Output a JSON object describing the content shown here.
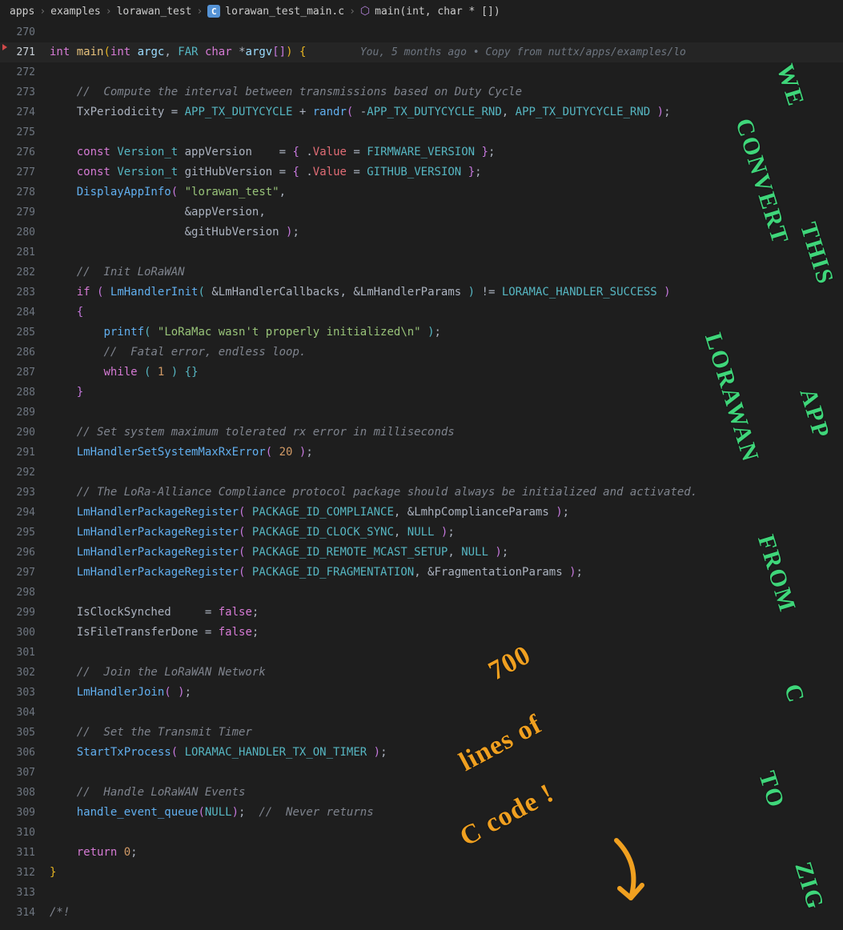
{
  "breadcrumbs": {
    "seg0": "apps",
    "seg1": "examples",
    "seg2": "lorawan_test",
    "seg3": "lorawan_test_main.c",
    "seg4": "main(int, char * [])",
    "c_icon": "C"
  },
  "codelens": "You, 5 months ago • Copy from nuttx/apps/examples/lo",
  "annot": {
    "g1": "We",
    "g2": "convert",
    "g3": "this",
    "g4": "LoRaWAN",
    "g5": "App",
    "g6": "from",
    "g7": "C",
    "g8": "to",
    "g9": "Zig",
    "o1": "700",
    "o2": "lines of",
    "o3": "C code !"
  },
  "lines": [
    {
      "n": "270",
      "t": []
    },
    {
      "n": "271",
      "hl": true,
      "t": [
        {
          "c": "kw",
          "v": "int"
        },
        {
          "c": "op",
          "v": " "
        },
        {
          "c": "fn",
          "v": "main"
        },
        {
          "c": "brace",
          "v": "("
        },
        {
          "c": "kw",
          "v": "int"
        },
        {
          "c": "op",
          "v": " "
        },
        {
          "c": "param",
          "v": "argc"
        },
        {
          "c": "op",
          "v": ", "
        },
        {
          "c": "type",
          "v": "FAR"
        },
        {
          "c": "op",
          "v": " "
        },
        {
          "c": "kw",
          "v": "char"
        },
        {
          "c": "op",
          "v": " *"
        },
        {
          "c": "param",
          "v": "argv"
        },
        {
          "c": "brace2",
          "v": "["
        },
        {
          "c": "brace2",
          "v": "]"
        },
        {
          "c": "brace",
          "v": ")"
        },
        {
          "c": "op",
          "v": " "
        },
        {
          "c": "brace",
          "v": "{"
        }
      ],
      "lens": true
    },
    {
      "n": "272",
      "t": []
    },
    {
      "n": "273",
      "t": [
        {
          "c": "op",
          "v": "    "
        },
        {
          "c": "cmt",
          "v": "//  Compute the interval between transmissions based on Duty Cycle"
        }
      ]
    },
    {
      "n": "274",
      "t": [
        {
          "c": "op",
          "v": "    "
        },
        {
          "c": "var",
          "v": "TxPeriodicity"
        },
        {
          "c": "op",
          "v": " = "
        },
        {
          "c": "const",
          "v": "APP_TX_DUTYCYCLE"
        },
        {
          "c": "op",
          "v": " + "
        },
        {
          "c": "call",
          "v": "randr"
        },
        {
          "c": "brace2",
          "v": "("
        },
        {
          "c": "op",
          "v": " -"
        },
        {
          "c": "const",
          "v": "APP_TX_DUTYCYCLE_RND"
        },
        {
          "c": "op",
          "v": ", "
        },
        {
          "c": "const",
          "v": "APP_TX_DUTYCYCLE_RND"
        },
        {
          "c": "op",
          "v": " "
        },
        {
          "c": "brace2",
          "v": ")"
        },
        {
          "c": "op",
          "v": ";"
        }
      ]
    },
    {
      "n": "275",
      "t": []
    },
    {
      "n": "276",
      "t": [
        {
          "c": "op",
          "v": "    "
        },
        {
          "c": "kw",
          "v": "const"
        },
        {
          "c": "op",
          "v": " "
        },
        {
          "c": "type",
          "v": "Version_t"
        },
        {
          "c": "op",
          "v": " "
        },
        {
          "c": "var",
          "v": "appVersion"
        },
        {
          "c": "op",
          "v": "    = "
        },
        {
          "c": "brace2",
          "v": "{"
        },
        {
          "c": "op",
          "v": " ."
        },
        {
          "c": "prop",
          "v": "Value"
        },
        {
          "c": "op",
          "v": " = "
        },
        {
          "c": "const",
          "v": "FIRMWARE_VERSION"
        },
        {
          "c": "op",
          "v": " "
        },
        {
          "c": "brace2",
          "v": "}"
        },
        {
          "c": "op",
          "v": ";"
        }
      ]
    },
    {
      "n": "277",
      "t": [
        {
          "c": "op",
          "v": "    "
        },
        {
          "c": "kw",
          "v": "const"
        },
        {
          "c": "op",
          "v": " "
        },
        {
          "c": "type",
          "v": "Version_t"
        },
        {
          "c": "op",
          "v": " "
        },
        {
          "c": "var",
          "v": "gitHubVersion"
        },
        {
          "c": "op",
          "v": " = "
        },
        {
          "c": "brace2",
          "v": "{"
        },
        {
          "c": "op",
          "v": " ."
        },
        {
          "c": "prop",
          "v": "Value"
        },
        {
          "c": "op",
          "v": " = "
        },
        {
          "c": "const",
          "v": "GITHUB_VERSION"
        },
        {
          "c": "op",
          "v": " "
        },
        {
          "c": "brace2",
          "v": "}"
        },
        {
          "c": "op",
          "v": ";"
        }
      ]
    },
    {
      "n": "278",
      "t": [
        {
          "c": "op",
          "v": "    "
        },
        {
          "c": "call",
          "v": "DisplayAppInfo"
        },
        {
          "c": "brace2",
          "v": "("
        },
        {
          "c": "op",
          "v": " "
        },
        {
          "c": "str",
          "v": "\"lorawan_test\""
        },
        {
          "c": "op",
          "v": ","
        }
      ]
    },
    {
      "n": "279",
      "t": [
        {
          "c": "op",
          "v": "                    &"
        },
        {
          "c": "var",
          "v": "appVersion"
        },
        {
          "c": "op",
          "v": ","
        }
      ]
    },
    {
      "n": "280",
      "t": [
        {
          "c": "op",
          "v": "                    &"
        },
        {
          "c": "var",
          "v": "gitHubVersion"
        },
        {
          "c": "op",
          "v": " "
        },
        {
          "c": "brace2",
          "v": ")"
        },
        {
          "c": "op",
          "v": ";"
        }
      ]
    },
    {
      "n": "281",
      "t": []
    },
    {
      "n": "282",
      "t": [
        {
          "c": "op",
          "v": "    "
        },
        {
          "c": "cmt",
          "v": "//  Init LoRaWAN"
        }
      ]
    },
    {
      "n": "283",
      "t": [
        {
          "c": "op",
          "v": "    "
        },
        {
          "c": "kw",
          "v": "if"
        },
        {
          "c": "op",
          "v": " "
        },
        {
          "c": "brace2",
          "v": "("
        },
        {
          "c": "op",
          "v": " "
        },
        {
          "c": "call",
          "v": "LmHandlerInit"
        },
        {
          "c": "brace3",
          "v": "("
        },
        {
          "c": "op",
          "v": " &"
        },
        {
          "c": "var",
          "v": "LmHandlerCallbacks"
        },
        {
          "c": "op",
          "v": ", &"
        },
        {
          "c": "var",
          "v": "LmHandlerParams"
        },
        {
          "c": "op",
          "v": " "
        },
        {
          "c": "brace3",
          "v": ")"
        },
        {
          "c": "op",
          "v": " != "
        },
        {
          "c": "const",
          "v": "LORAMAC_HANDLER_SUCCESS"
        },
        {
          "c": "op",
          "v": " "
        },
        {
          "c": "brace2",
          "v": ")"
        }
      ]
    },
    {
      "n": "284",
      "t": [
        {
          "c": "op",
          "v": "    "
        },
        {
          "c": "brace2",
          "v": "{"
        }
      ]
    },
    {
      "n": "285",
      "t": [
        {
          "c": "op",
          "v": "        "
        },
        {
          "c": "call",
          "v": "printf"
        },
        {
          "c": "brace3",
          "v": "("
        },
        {
          "c": "op",
          "v": " "
        },
        {
          "c": "str",
          "v": "\"LoRaMac wasn't properly initialized\\n\""
        },
        {
          "c": "op",
          "v": " "
        },
        {
          "c": "brace3",
          "v": ")"
        },
        {
          "c": "op",
          "v": ";"
        }
      ]
    },
    {
      "n": "286",
      "t": [
        {
          "c": "op",
          "v": "        "
        },
        {
          "c": "cmt",
          "v": "//  Fatal error, endless loop."
        }
      ]
    },
    {
      "n": "287",
      "t": [
        {
          "c": "op",
          "v": "        "
        },
        {
          "c": "kw",
          "v": "while"
        },
        {
          "c": "op",
          "v": " "
        },
        {
          "c": "brace3",
          "v": "("
        },
        {
          "c": "op",
          "v": " "
        },
        {
          "c": "num",
          "v": "1"
        },
        {
          "c": "op",
          "v": " "
        },
        {
          "c": "brace3",
          "v": ")"
        },
        {
          "c": "op",
          "v": " "
        },
        {
          "c": "brace3",
          "v": "{"
        },
        {
          "c": "brace3",
          "v": "}"
        }
      ]
    },
    {
      "n": "288",
      "t": [
        {
          "c": "op",
          "v": "    "
        },
        {
          "c": "brace2",
          "v": "}"
        }
      ]
    },
    {
      "n": "289",
      "t": []
    },
    {
      "n": "290",
      "t": [
        {
          "c": "op",
          "v": "    "
        },
        {
          "c": "cmt",
          "v": "// Set system maximum tolerated rx error in milliseconds"
        }
      ]
    },
    {
      "n": "291",
      "t": [
        {
          "c": "op",
          "v": "    "
        },
        {
          "c": "call",
          "v": "LmHandlerSetSystemMaxRxError"
        },
        {
          "c": "brace2",
          "v": "("
        },
        {
          "c": "op",
          "v": " "
        },
        {
          "c": "num",
          "v": "20"
        },
        {
          "c": "op",
          "v": " "
        },
        {
          "c": "brace2",
          "v": ")"
        },
        {
          "c": "op",
          "v": ";"
        }
      ]
    },
    {
      "n": "292",
      "t": []
    },
    {
      "n": "293",
      "t": [
        {
          "c": "op",
          "v": "    "
        },
        {
          "c": "cmt",
          "v": "// The LoRa-Alliance Compliance protocol package should always be initialized and activated."
        }
      ]
    },
    {
      "n": "294",
      "t": [
        {
          "c": "op",
          "v": "    "
        },
        {
          "c": "call",
          "v": "LmHandlerPackageRegister"
        },
        {
          "c": "brace2",
          "v": "("
        },
        {
          "c": "op",
          "v": " "
        },
        {
          "c": "const",
          "v": "PACKAGE_ID_COMPLIANCE"
        },
        {
          "c": "op",
          "v": ", &"
        },
        {
          "c": "var",
          "v": "LmhpComplianceParams"
        },
        {
          "c": "op",
          "v": " "
        },
        {
          "c": "brace2",
          "v": ")"
        },
        {
          "c": "op",
          "v": ";"
        }
      ]
    },
    {
      "n": "295",
      "t": [
        {
          "c": "op",
          "v": "    "
        },
        {
          "c": "call",
          "v": "LmHandlerPackageRegister"
        },
        {
          "c": "brace2",
          "v": "("
        },
        {
          "c": "op",
          "v": " "
        },
        {
          "c": "const",
          "v": "PACKAGE_ID_CLOCK_SYNC"
        },
        {
          "c": "op",
          "v": ", "
        },
        {
          "c": "const",
          "v": "NULL"
        },
        {
          "c": "op",
          "v": " "
        },
        {
          "c": "brace2",
          "v": ")"
        },
        {
          "c": "op",
          "v": ";"
        }
      ]
    },
    {
      "n": "296",
      "t": [
        {
          "c": "op",
          "v": "    "
        },
        {
          "c": "call",
          "v": "LmHandlerPackageRegister"
        },
        {
          "c": "brace2",
          "v": "("
        },
        {
          "c": "op",
          "v": " "
        },
        {
          "c": "const",
          "v": "PACKAGE_ID_REMOTE_MCAST_SETUP"
        },
        {
          "c": "op",
          "v": ", "
        },
        {
          "c": "const",
          "v": "NULL"
        },
        {
          "c": "op",
          "v": " "
        },
        {
          "c": "brace2",
          "v": ")"
        },
        {
          "c": "op",
          "v": ";"
        }
      ]
    },
    {
      "n": "297",
      "t": [
        {
          "c": "op",
          "v": "    "
        },
        {
          "c": "call",
          "v": "LmHandlerPackageRegister"
        },
        {
          "c": "brace2",
          "v": "("
        },
        {
          "c": "op",
          "v": " "
        },
        {
          "c": "const",
          "v": "PACKAGE_ID_FRAGMENTATION"
        },
        {
          "c": "op",
          "v": ", &"
        },
        {
          "c": "var",
          "v": "FragmentationParams"
        },
        {
          "c": "op",
          "v": " "
        },
        {
          "c": "brace2",
          "v": ")"
        },
        {
          "c": "op",
          "v": ";"
        }
      ]
    },
    {
      "n": "298",
      "t": []
    },
    {
      "n": "299",
      "t": [
        {
          "c": "op",
          "v": "    "
        },
        {
          "c": "var",
          "v": "IsClockSynched"
        },
        {
          "c": "op",
          "v": "     = "
        },
        {
          "c": "kw",
          "v": "false"
        },
        {
          "c": "op",
          "v": ";"
        }
      ]
    },
    {
      "n": "300",
      "t": [
        {
          "c": "op",
          "v": "    "
        },
        {
          "c": "var",
          "v": "IsFileTransferDone"
        },
        {
          "c": "op",
          "v": " = "
        },
        {
          "c": "kw",
          "v": "false"
        },
        {
          "c": "op",
          "v": ";"
        }
      ]
    },
    {
      "n": "301",
      "t": []
    },
    {
      "n": "302",
      "t": [
        {
          "c": "op",
          "v": "    "
        },
        {
          "c": "cmt",
          "v": "//  Join the LoRaWAN Network"
        }
      ]
    },
    {
      "n": "303",
      "t": [
        {
          "c": "op",
          "v": "    "
        },
        {
          "c": "call",
          "v": "LmHandlerJoin"
        },
        {
          "c": "brace2",
          "v": "("
        },
        {
          "c": "op",
          "v": " "
        },
        {
          "c": "brace2",
          "v": ")"
        },
        {
          "c": "op",
          "v": ";"
        }
      ]
    },
    {
      "n": "304",
      "t": []
    },
    {
      "n": "305",
      "t": [
        {
          "c": "op",
          "v": "    "
        },
        {
          "c": "cmt",
          "v": "//  Set the Transmit Timer"
        }
      ]
    },
    {
      "n": "306",
      "t": [
        {
          "c": "op",
          "v": "    "
        },
        {
          "c": "call",
          "v": "StartTxProcess"
        },
        {
          "c": "brace2",
          "v": "("
        },
        {
          "c": "op",
          "v": " "
        },
        {
          "c": "const",
          "v": "LORAMAC_HANDLER_TX_ON_TIMER"
        },
        {
          "c": "op",
          "v": " "
        },
        {
          "c": "brace2",
          "v": ")"
        },
        {
          "c": "op",
          "v": ";"
        }
      ]
    },
    {
      "n": "307",
      "t": []
    },
    {
      "n": "308",
      "t": [
        {
          "c": "op",
          "v": "    "
        },
        {
          "c": "cmt",
          "v": "//  Handle LoRaWAN Events"
        }
      ]
    },
    {
      "n": "309",
      "t": [
        {
          "c": "op",
          "v": "    "
        },
        {
          "c": "call",
          "v": "handle_event_queue"
        },
        {
          "c": "brace2",
          "v": "("
        },
        {
          "c": "const",
          "v": "NULL"
        },
        {
          "c": "brace2",
          "v": ")"
        },
        {
          "c": "op",
          "v": ";"
        },
        {
          "c": "op",
          "v": "  "
        },
        {
          "c": "cmt",
          "v": "//  Never returns"
        }
      ]
    },
    {
      "n": "310",
      "t": []
    },
    {
      "n": "311",
      "t": [
        {
          "c": "op",
          "v": "    "
        },
        {
          "c": "kw",
          "v": "return"
        },
        {
          "c": "op",
          "v": " "
        },
        {
          "c": "num",
          "v": "0"
        },
        {
          "c": "op",
          "v": ";"
        }
      ]
    },
    {
      "n": "312",
      "t": [
        {
          "c": "brace",
          "v": "}"
        }
      ]
    },
    {
      "n": "313",
      "t": []
    },
    {
      "n": "314",
      "t": [
        {
          "c": "cmt",
          "v": "/*!"
        }
      ]
    }
  ]
}
